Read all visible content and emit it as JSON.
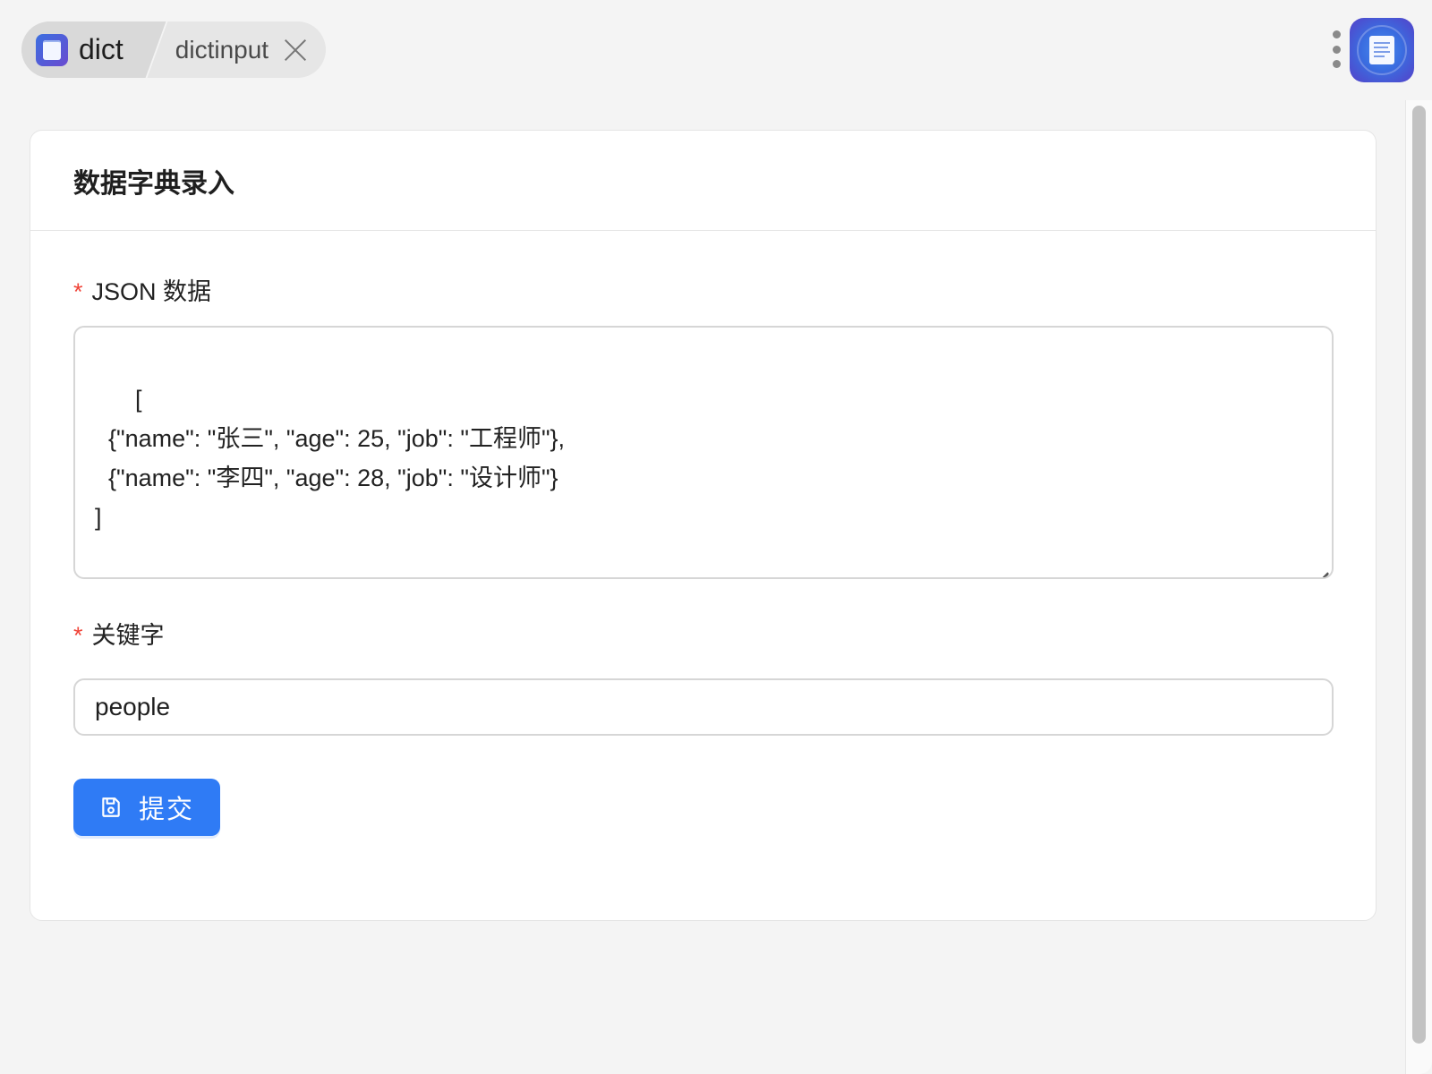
{
  "tabs": {
    "active_label": "dict",
    "inactive_label": "dictinput"
  },
  "card": {
    "title": "数据字典录入"
  },
  "form": {
    "json_field": {
      "required_mark": "*",
      "label": "JSON 数据",
      "value": "[\n  {\"name\": \"张三\", \"age\": 25, \"job\": \"工程师\"},\n  {\"name\": \"李四\", \"age\": 28, \"job\": \"设计师\"}\n]"
    },
    "keyword_field": {
      "required_mark": "*",
      "label": "关键字",
      "value": "people"
    },
    "submit_label": "提交"
  },
  "colors": {
    "primary": "#2f7bf5",
    "required": "#f04438",
    "background": "#f4f4f4"
  },
  "icons": {
    "tab_icon": "document-icon",
    "close": "close-icon",
    "more": "more-vertical-icon",
    "app": "app-document-icon",
    "submit": "save-icon"
  }
}
